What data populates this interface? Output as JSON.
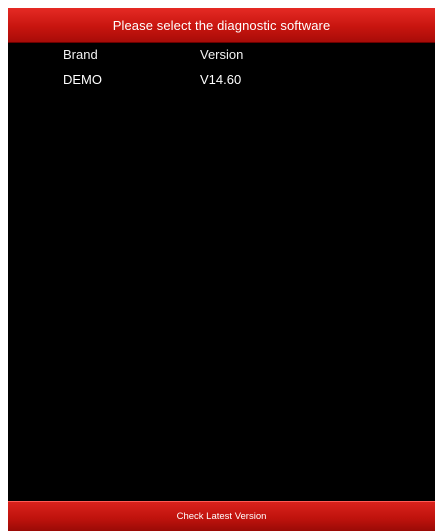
{
  "header": {
    "title": "Please select the diagnostic software"
  },
  "table": {
    "columns": [
      "Brand",
      "Version"
    ],
    "rows": [
      {
        "brand": "DEMO",
        "version": "V14.60"
      }
    ]
  },
  "footer": {
    "button_label": "Check Latest Version"
  },
  "colors": {
    "header_red": "#c8150f",
    "background": "#000000",
    "text": "#ffffff"
  }
}
